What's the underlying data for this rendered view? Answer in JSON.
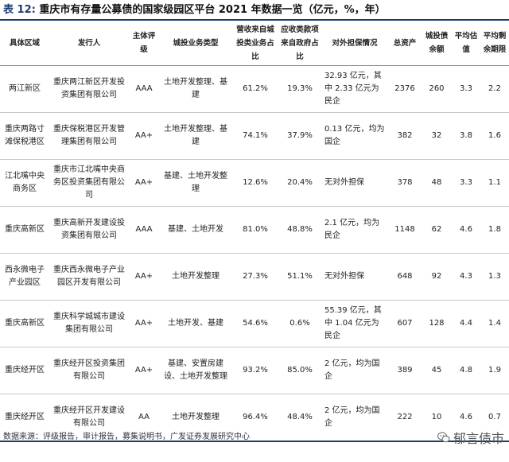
{
  "title": {
    "tag": "表 12:",
    "text": "重庆市有存量公募债的国家级园区平台 2021 年数据一览（亿元，%，年）"
  },
  "columns": [
    "具体区域",
    "发行人",
    "主体评级",
    "城投业务类型",
    "营收来自城投类业务占比",
    "应收类款项来自政府占比",
    "对外担保情况",
    "总资产",
    "城投债余额",
    "平均估值",
    "平均剩余期限"
  ],
  "rows": [
    [
      "两江新区",
      "重庆两江新区开发投资集团有限公司",
      "AAA",
      "土地开发整理、基建",
      "61.2%",
      "19.3%",
      "32.93 亿元，其中 2.33 亿元为民企",
      "2376",
      "260",
      "3.3",
      "2.2"
    ],
    [
      "重庆两路寸滩保税港区",
      "重庆保税港区开发管理集团有限公司",
      "AA+",
      "土地开发整理、基建",
      "74.1%",
      "37.9%",
      "0.13 亿元，均为国企",
      "382",
      "32",
      "3.8",
      "1.6"
    ],
    [
      "江北嘴中央商务区",
      "重庆市江北嘴中央商务区投资集团有限公司",
      "AA+",
      "基建、土地开发整理",
      "12.6%",
      "20.4%",
      "无对外担保",
      "378",
      "48",
      "3.3",
      "1.1"
    ],
    [
      "重庆高新区",
      "重庆高新开发建设投资集团有限公司",
      "AAA",
      "基建、土地开发",
      "81.0%",
      "48.8%",
      "2.1 亿元，均为民企",
      "1148",
      "62",
      "4.6",
      "1.8"
    ],
    [
      "西永微电子产业园区",
      "重庆西永微电子产业园区开发有限公司",
      "AA+",
      "土地开发整理",
      "27.3%",
      "51.1%",
      "无对外担保",
      "648",
      "92",
      "4.3",
      "1.3"
    ],
    [
      "重庆高新区",
      "重庆科学城城市建设集团有限公司",
      "AA+",
      "土地开发、基建",
      "54.6%",
      "0.6%",
      "55.39 亿元，其中 1.04 亿元为民企",
      "607",
      "128",
      "4.4",
      "1.4"
    ],
    [
      "重庆经开区",
      "重庆经开区投资集团有限公司",
      "AA+",
      "基建、安置房建设、土地开发整理",
      "93.2%",
      "85.0%",
      "2 亿元，均为国企",
      "389",
      "45",
      "4.8",
      "1.9"
    ],
    [
      "重庆经开区",
      "重庆经开区开发建设有限公司",
      "AA",
      "土地开发整理",
      "96.4%",
      "48.4%",
      "2 亿元，均为国企",
      "222",
      "10",
      "4.6",
      "0.7"
    ]
  ],
  "source": "数据来源：评级报告，审计报告，募集说明书，广发证券发展研究中心",
  "watermark": "郁言债市",
  "colors": {
    "accent": "#1f3a73"
  }
}
